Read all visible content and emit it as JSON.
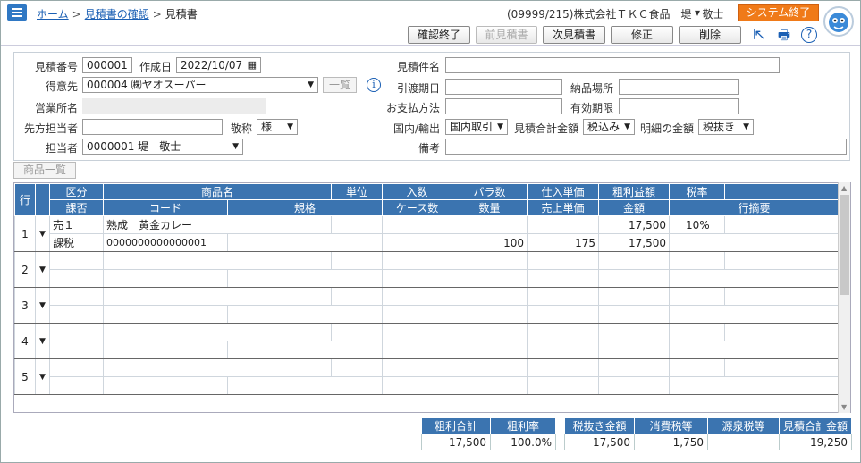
{
  "breadcrumb": {
    "home": "ホーム",
    "confirm": "見積書の確認",
    "current": "見積書",
    "sep": ">"
  },
  "header": {
    "company": "(09999/215)株式会社ＴＫＣ食品　堤　敬士",
    "user_menu": "▾",
    "system_end": "システム終了"
  },
  "toolbar": {
    "confirm_end": "確認終了",
    "prev": "前見積書",
    "next": "次見積書",
    "edit": "修正",
    "delete": "削除",
    "export_icon": "⇱",
    "print_icon": "🖶",
    "help_icon": "?"
  },
  "form": {
    "quote_no_label": "見積番号",
    "quote_no": "000001",
    "created_label": "作成日",
    "created": "2022/10/07",
    "customer_label": "得意先",
    "customer": "000004 ㈱ヤオスーパー",
    "list_btn": "一覧",
    "sales_office_label": "営業所名",
    "contact_label": "先方担当者",
    "honor_label": "敬称",
    "honor": "様",
    "staff_label": "担当者",
    "staff": "0000001 堤　敬士",
    "subject_label": "見積件名",
    "delivery_label": "引渡期日",
    "place_label": "納品場所",
    "payment_label": "お支払方法",
    "valid_label": "有効期限",
    "domestic_label": "国内/輸出",
    "domestic": "国内取引",
    "total_label": "見積合計金額",
    "total_tax": "税込み",
    "detail_label": "明細の金額",
    "detail_tax": "税抜き",
    "note_label": "備考"
  },
  "product_list_btn": "商品一覧",
  "grid": {
    "h1": [
      "行",
      "区分",
      "商品名",
      "単位",
      "入数",
      "バラ数",
      "仕入単価",
      "粗利益額",
      "税率"
    ],
    "h2": [
      "課否",
      "コード",
      "規格",
      "ケース数",
      "数量",
      "売上単価",
      "金額",
      "行摘要"
    ],
    "rows": [
      {
        "n": "1",
        "kubun": "売１",
        "name": "熟成　黄金カレー",
        "gross": "17,500",
        "rate": "10%",
        "kahi": "課税",
        "code": "0000000000000001",
        "qty": "100",
        "price": "175",
        "amount": "17,500"
      },
      {
        "n": "2"
      },
      {
        "n": "3"
      },
      {
        "n": "4"
      },
      {
        "n": "5"
      }
    ]
  },
  "totals": {
    "gross_h": "粗利合計",
    "gross": "17,500",
    "gross_rate_h": "粗利率",
    "gross_rate": "100.0%",
    "excl_h": "税抜き金額",
    "excl": "17,500",
    "cons_h": "消費税等",
    "cons": "1,750",
    "src_h": "源泉税等",
    "src": "",
    "total_h": "見積合計金額",
    "total": "19,250"
  }
}
